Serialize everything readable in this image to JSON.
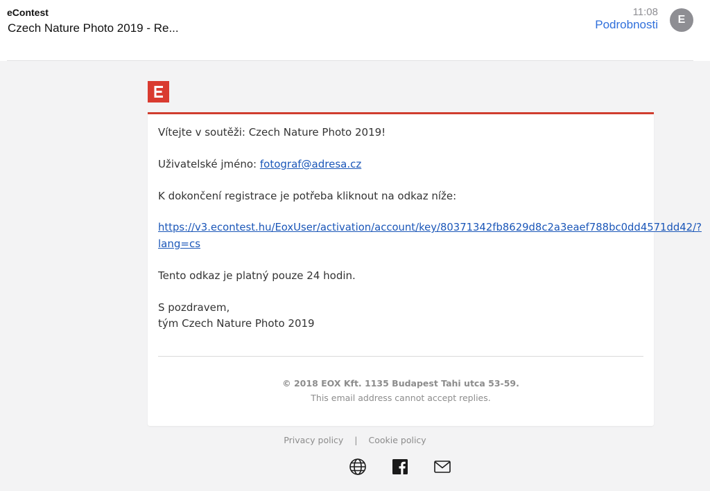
{
  "header": {
    "sender": "eContest",
    "subject": "Czech Nature Photo 2019 - Re...",
    "time": "11:08",
    "details_label": "Podrobnosti",
    "avatar_initial": "E"
  },
  "email": {
    "brand_color": "#d93b30",
    "greeting": "Vítejte v soutěži: Czech Nature Photo 2019!",
    "username_label": "Uživatelské jméno:",
    "username_value": "fotograf@adresa.cz",
    "instruction": "K dokončení registrace je potřeba kliknout na odkaz níže:",
    "activation_link_line1": "https://v3.econtest.hu/EoxUser/activation/account/key/80371342fb8629d8c2a3eaef788bc0dd4571dd42/?",
    "activation_link_line2": "lang=cs",
    "validity": "Tento odkaz je platný pouze 24 hodin.",
    "closing_1": "S pozdravem,",
    "closing_2": "tým Czech Nature Photo 2019",
    "footer_company": "© 2018 EOX Kft. 1135 Budapest Tahi utca 53-59.",
    "footer_note": "This email address cannot accept replies."
  },
  "links": {
    "privacy": "Privacy policy",
    "separator": "|",
    "cookie": "Cookie policy"
  },
  "social_icons": [
    "globe-icon",
    "facebook-icon",
    "mail-icon"
  ]
}
